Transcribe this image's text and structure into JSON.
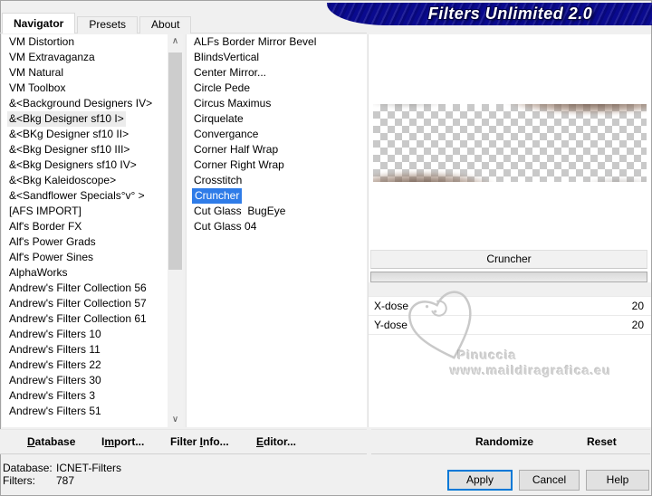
{
  "banner": {
    "title": "Filters Unlimited 2.0",
    "bg_color": "#0a0a8e",
    "text_color": "#ffffff"
  },
  "tabs": {
    "navigator": "Navigator",
    "presets": "Presets",
    "about": "About"
  },
  "icons": {
    "scroll_up": "∧",
    "scroll_down": "∨"
  },
  "colors": {
    "selection_blue": "#2f7ce8",
    "apply_focus_border": "#0078d7"
  },
  "navigator_list": {
    "items": [
      {
        "label": "VM Distortion"
      },
      {
        "label": "VM Extravaganza"
      },
      {
        "label": "VM Natural"
      },
      {
        "label": "VM Toolbox"
      },
      {
        "label": "&<Background Designers IV>"
      },
      {
        "label": "&<Bkg Designer sf10 I>",
        "highlighted": true
      },
      {
        "label": "&<BKg Designer sf10 II>"
      },
      {
        "label": "&<Bkg Designer sf10 III>"
      },
      {
        "label": "&<Bkg Designers sf10 IV>"
      },
      {
        "label": "&<Bkg Kaleidoscope>"
      },
      {
        "label": "&<Sandflower Specials°v° >"
      },
      {
        "label": "[AFS IMPORT]"
      },
      {
        "label": "Alf's Border FX"
      },
      {
        "label": "Alf's Power Grads"
      },
      {
        "label": "Alf's Power Sines"
      },
      {
        "label": "AlphaWorks"
      },
      {
        "label": "Andrew's Filter Collection 56"
      },
      {
        "label": "Andrew's Filter Collection 57"
      },
      {
        "label": "Andrew's Filter Collection 61"
      },
      {
        "label": "Andrew's Filters 10"
      },
      {
        "label": "Andrew's Filters 11"
      },
      {
        "label": "Andrew's Filters 22"
      },
      {
        "label": "Andrew's Filters 30"
      },
      {
        "label": "Andrew's Filters 3"
      },
      {
        "label": "Andrew's Filters 51"
      }
    ]
  },
  "filter_list": {
    "items": [
      {
        "label": "ALFs Border Mirror Bevel"
      },
      {
        "label": "BlindsVertical"
      },
      {
        "label": "Center Mirror..."
      },
      {
        "label": "Circle Pede"
      },
      {
        "label": "Circus Maximus"
      },
      {
        "label": "Cirquelate"
      },
      {
        "label": "Convergance"
      },
      {
        "label": "Corner Half Wrap"
      },
      {
        "label": "Corner Right Wrap"
      },
      {
        "label": "Crosstitch"
      },
      {
        "label": "Cruncher",
        "selected": true
      },
      {
        "label": "Cut Glass  BugEye"
      },
      {
        "label": "Cut Glass 04"
      }
    ]
  },
  "controls": {
    "filter_name": "Cruncher",
    "params": [
      {
        "name": "X-dose",
        "value": "20"
      },
      {
        "name": "Y-dose",
        "value": "20"
      }
    ]
  },
  "watermark": {
    "name": "Pinuccia",
    "site": "www.maildiragrafica.eu"
  },
  "toolbar": {
    "database": {
      "pre": "",
      "key": "D",
      "post": "atabase"
    },
    "import": {
      "pre": "I",
      "key": "m",
      "post": "port..."
    },
    "filter_info": {
      "pre": "Filter ",
      "key": "I",
      "post": "nfo..."
    },
    "editor": {
      "pre": "",
      "key": "E",
      "post": "ditor..."
    },
    "randomize": "Randomize",
    "reset": "Reset"
  },
  "status": {
    "database_label": "Database:",
    "database_value": "ICNET-Filters",
    "filters_label": "Filters:",
    "filters_value": "787"
  },
  "buttons": {
    "apply": "Apply",
    "cancel": "Cancel",
    "help": "Help"
  }
}
